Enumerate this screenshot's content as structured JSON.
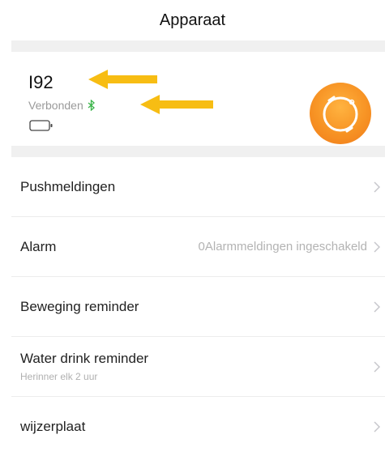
{
  "header": {
    "title": "Apparaat"
  },
  "device": {
    "name": "I92",
    "status": "Verbonden",
    "bluetooth_icon": "bluetooth-icon",
    "battery_icon": "battery-icon",
    "avatar_icon": "smartwatch-icon",
    "arrow_color": "#f7bd13",
    "avatar_color": "#f79324"
  },
  "menu": {
    "items": [
      {
        "label": "Pushmeldingen",
        "value": "",
        "sub": ""
      },
      {
        "label": "Alarm",
        "value": "0Alarmmeldingen ingeschakeld",
        "sub": ""
      },
      {
        "label": "Beweging reminder",
        "value": "",
        "sub": ""
      },
      {
        "label": "Water drink reminder",
        "value": "",
        "sub": "Herinner elk 2 uur"
      },
      {
        "label": "wijzerplaat",
        "value": "",
        "sub": ""
      }
    ]
  }
}
